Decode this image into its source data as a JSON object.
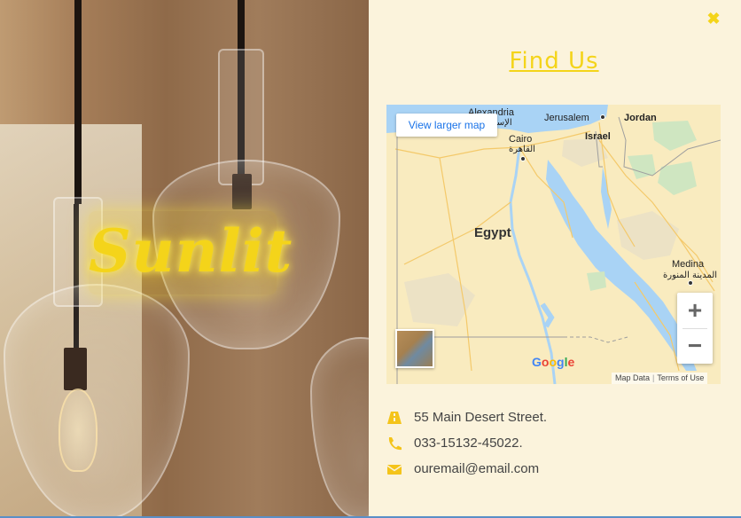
{
  "brand": {
    "logo_text": "Sunlit"
  },
  "panel": {
    "title": "Find Us",
    "close_glyph": "✖"
  },
  "map": {
    "larger_map_label": "View larger map",
    "zoom_in_glyph": "+",
    "zoom_out_glyph": "−",
    "google_logo": [
      "G",
      "o",
      "o",
      "g",
      "l",
      "e"
    ],
    "google_colors": [
      "#4285f4",
      "#ea4335",
      "#fbbc05",
      "#4285f4",
      "#34a853",
      "#ea4335"
    ],
    "attribution": {
      "map_data": "Map Data",
      "terms": "Terms of Use"
    },
    "labels": {
      "alexandria": "Alexandria",
      "alexandria_ar": "الإسكندرية",
      "jerusalem": "Jerusalem",
      "jordan": "Jordan",
      "cairo": "Cairo",
      "cairo_ar": "القاهرة",
      "israel": "Israel",
      "egypt": "Egypt",
      "medina": "Medina",
      "medina_ar": "المدينة المنورة"
    },
    "colors": {
      "land": "#f9ebbf",
      "water": "#a9d3f5",
      "roads": "#f4c96a",
      "green": "#cfe6c1"
    }
  },
  "contact": {
    "address": "55 Main Desert Street.",
    "phone": "033-15132-45022.",
    "email": "ouremail@email.com",
    "icons": [
      "road-icon",
      "phone-icon",
      "envelope-icon"
    ],
    "accent": "#f4c41a"
  }
}
